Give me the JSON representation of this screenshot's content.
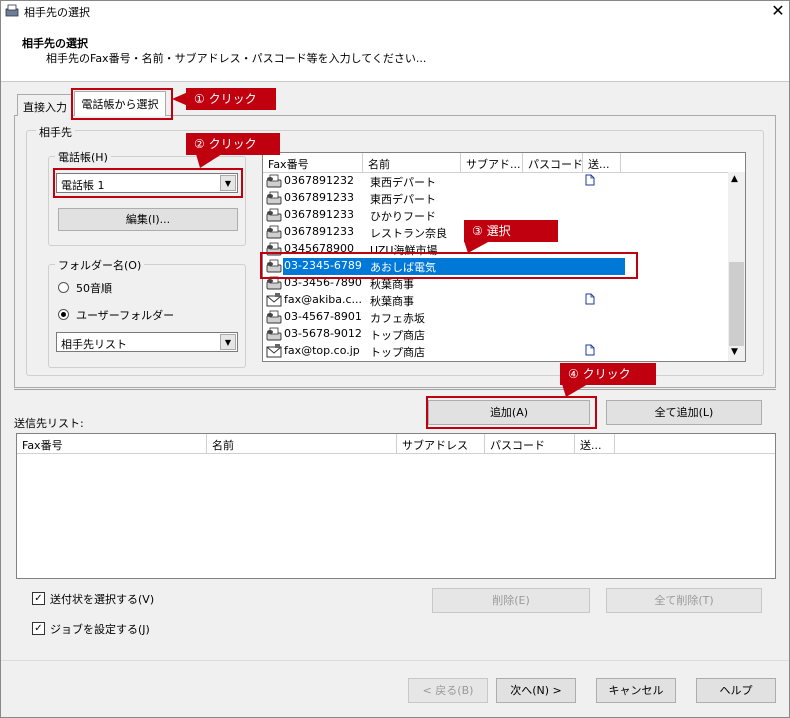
{
  "window": {
    "title": "相手先の選択",
    "close_glyph": "✕"
  },
  "header": {
    "title": "相手先の選択",
    "subtitle": "相手先のFax番号・名前・サブアドレス・パスコード等を入力してください..."
  },
  "tabs": [
    {
      "label": "直接入力"
    },
    {
      "label": "電話帳から選択"
    }
  ],
  "recipient_group": {
    "label": "相手先"
  },
  "phonebook_group": {
    "label": "電話帳(H)",
    "selected": "電話帳 1",
    "edit_button": "編集(I)..."
  },
  "folder_group": {
    "label": "フォルダー名(O)",
    "option_50": "50音順",
    "option_user": "ユーザーフォルダー",
    "selected_option": "ユーザーフォルダー",
    "folder_selected": "相手先リスト"
  },
  "contact_list": {
    "columns": [
      "Fax番号",
      "名前",
      "サブアド...",
      "パスコード",
      "送..."
    ],
    "rows": [
      {
        "fax": "0367891232",
        "name": "東西デパート",
        "icon": "fax-machine-icon",
        "doc": true
      },
      {
        "fax": "0367891233",
        "name": "東西デパート",
        "icon": "fax-machine-icon",
        "doc": false
      },
      {
        "fax": "0367891233",
        "name": "ひかりフード",
        "icon": "fax-machine-icon",
        "doc": false
      },
      {
        "fax": "0367891233",
        "name": "レストラン奈良",
        "icon": "fax-machine-icon",
        "doc": false
      },
      {
        "fax": "0345678900",
        "name": "UZU海鮮市場",
        "icon": "fax-machine-icon",
        "doc": false
      },
      {
        "fax": "03-2345-6789",
        "name": "あおしば電気",
        "icon": "fax-machine-icon",
        "doc": false,
        "selected": true
      },
      {
        "fax": "03-3456-7890",
        "name": "秋葉商事",
        "icon": "fax-machine-icon",
        "doc": false
      },
      {
        "fax": "fax@akiba.c...",
        "name": "秋葉商事",
        "icon": "email-fax-icon",
        "doc": true
      },
      {
        "fax": "03-4567-8901",
        "name": "カフェ赤坂",
        "icon": "fax-machine-icon",
        "doc": false
      },
      {
        "fax": "03-5678-9012",
        "name": "トップ商店",
        "icon": "fax-machine-icon",
        "doc": false
      },
      {
        "fax": "fax@top.co.jp",
        "name": "トップ商店",
        "icon": "email-fax-icon",
        "doc": true
      }
    ]
  },
  "buttons": {
    "add": "追加(A)",
    "add_all": "全て追加(L)",
    "delete": "削除(E)",
    "delete_all": "全て削除(T)",
    "back": "< 戻る(B)",
    "next": "次へ(N) >",
    "cancel": "キャンセル",
    "help": "ヘルプ"
  },
  "send_list": {
    "label": "送信先リスト:",
    "columns": [
      "Fax番号",
      "名前",
      "サブアドレス",
      "パスコード",
      "送..."
    ]
  },
  "options": {
    "cover_sheet": {
      "label": "送付状を選択する(V)",
      "checked": true
    },
    "job_settings": {
      "label": "ジョブを設定する(J)",
      "checked": true
    }
  },
  "annotations": [
    {
      "text": "① クリック"
    },
    {
      "text": "② クリック"
    },
    {
      "text": "③ 選択"
    },
    {
      "text": "④ クリック"
    }
  ],
  "colors": {
    "annotation_red": "#c0000f",
    "selection_blue": "#0078d7"
  }
}
